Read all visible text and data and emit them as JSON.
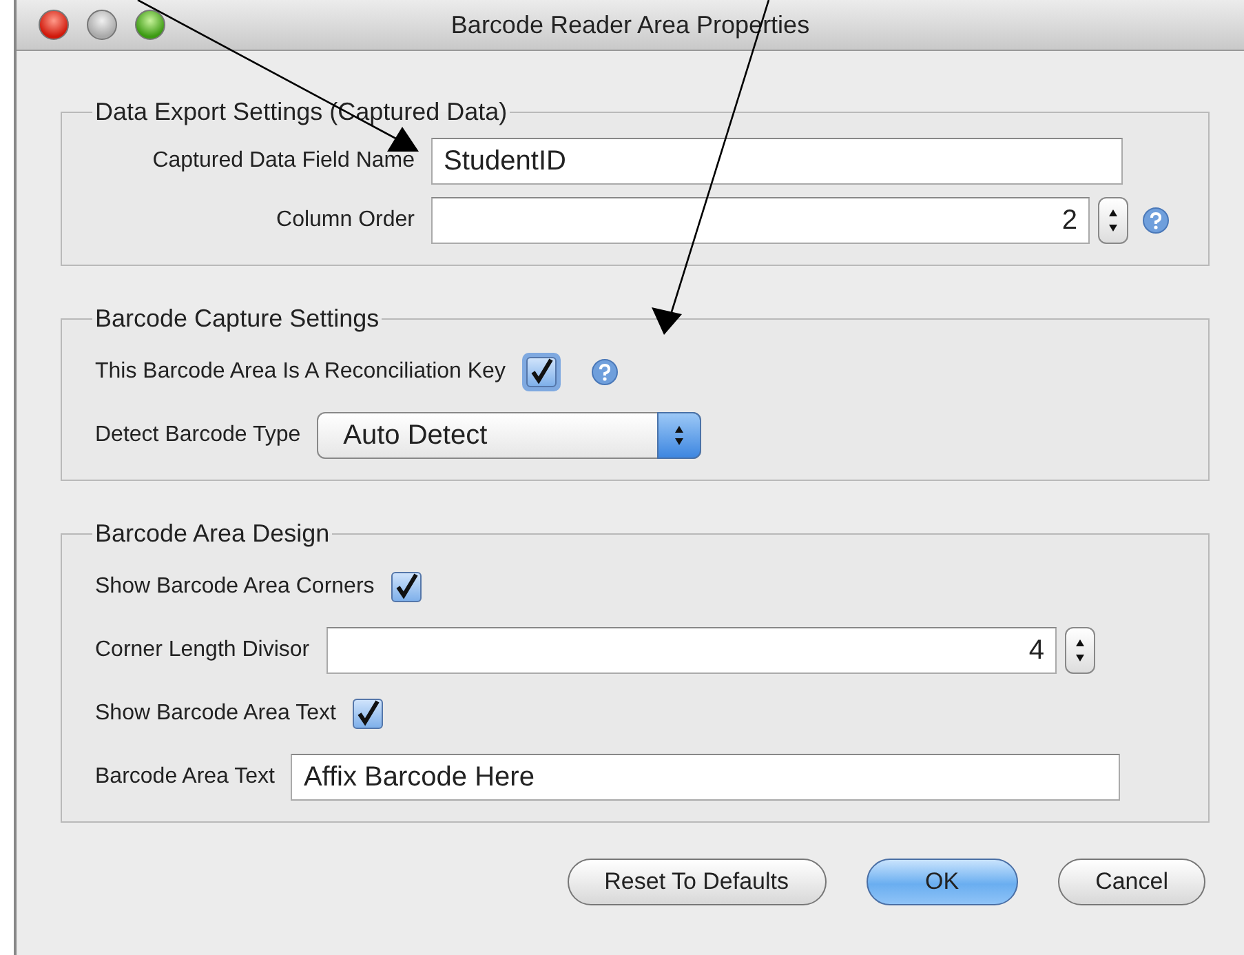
{
  "window": {
    "title": "Barcode Reader Area Properties"
  },
  "groups": [
    {
      "title": "Data Export Settings (Captured Data)",
      "kind": "form",
      "rows": [
        {
          "kind": "text",
          "label": "Captured Data Field Name",
          "value": "StudentID"
        },
        {
          "kind": "spinner",
          "label": "Column Order",
          "value": "2",
          "help": true
        }
      ]
    },
    {
      "title": "Barcode Capture Settings",
      "kind": "inline",
      "rows": [
        {
          "kind": "checkbox",
          "label": "This Barcode Area Is A Reconciliation Key",
          "checked": true,
          "focused": true,
          "help": true
        },
        {
          "kind": "select",
          "label": "Detect Barcode Type",
          "value": "Auto Detect"
        }
      ]
    },
    {
      "title": "Barcode Area Design",
      "kind": "inline",
      "rows": [
        {
          "kind": "checkbox",
          "label": "Show Barcode Area Corners",
          "checked": true,
          "focused": false,
          "help": false
        },
        {
          "kind": "spinner",
          "label": "Corner Length Divisor",
          "value": "4",
          "help": false
        },
        {
          "kind": "checkbox",
          "label": "Show Barcode Area Text",
          "checked": true,
          "focused": false,
          "help": false
        },
        {
          "kind": "text",
          "label": "Barcode Area Text",
          "value": "Affix Barcode Here"
        }
      ]
    }
  ],
  "buttons": [
    {
      "label": "Reset To Defaults",
      "default": false
    },
    {
      "label": "OK",
      "default": true
    },
    {
      "label": "Cancel",
      "default": false
    }
  ]
}
